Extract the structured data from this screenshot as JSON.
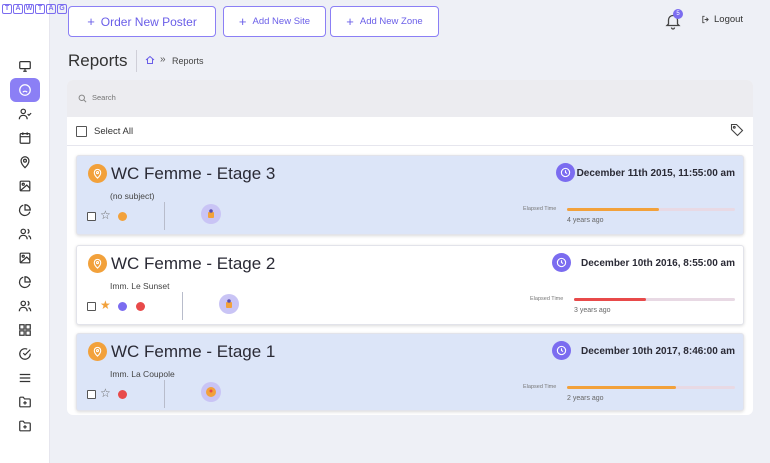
{
  "logo": {
    "letters": [
      "T",
      "A",
      "W",
      "T",
      "A",
      "G"
    ]
  },
  "sidebar": {
    "items": [
      {
        "name": "sidebar-item-monitor",
        "icon": "monitor-icon",
        "active": false
      },
      {
        "name": "sidebar-item-reports",
        "icon": "face-icon",
        "active": true
      },
      {
        "name": "sidebar-item-users-check",
        "icon": "user-check-icon",
        "active": false
      },
      {
        "name": "sidebar-item-calendar",
        "icon": "calendar-icon",
        "active": false
      },
      {
        "name": "sidebar-item-locations",
        "icon": "map-pin-icon",
        "active": false
      },
      {
        "name": "sidebar-item-images",
        "icon": "image-icon",
        "active": false
      },
      {
        "name": "sidebar-item-stats",
        "icon": "pie-chart-icon",
        "active": false
      },
      {
        "name": "sidebar-item-team",
        "icon": "users-icon",
        "active": false
      },
      {
        "name": "sidebar-item-gallery",
        "icon": "image-icon",
        "active": false
      },
      {
        "name": "sidebar-item-analytics",
        "icon": "pie-chart-icon",
        "active": false
      },
      {
        "name": "sidebar-item-people",
        "icon": "users-icon",
        "active": false
      },
      {
        "name": "sidebar-item-grid",
        "icon": "grid-icon",
        "active": false
      },
      {
        "name": "sidebar-item-tasks",
        "icon": "check-circle-icon",
        "active": false
      },
      {
        "name": "sidebar-item-list",
        "icon": "menu-icon",
        "active": false
      },
      {
        "name": "sidebar-item-folder-add",
        "icon": "folder-plus-icon",
        "active": false
      },
      {
        "name": "sidebar-item-folder-new",
        "icon": "folder-plus-icon",
        "active": false
      }
    ]
  },
  "topbar": {
    "order_poster": "Order New Poster",
    "add_site": "Add New Site",
    "add_zone": "Add New Zone",
    "notifications_count": "5",
    "logout": "Logout"
  },
  "page": {
    "title": "Reports",
    "breadcrumb_current": "Reports",
    "breadcrumb_sep": "»"
  },
  "search": {
    "placeholder": "Search"
  },
  "select_all": {
    "label": "Select All"
  },
  "colors": {
    "accent": "#7b6cf0",
    "orange": "#f2a13b",
    "red": "#e84a4a"
  },
  "reports": [
    {
      "title": "WC Femme - Etage 3",
      "subject": "(no subject)",
      "date": "December 11th 2015, 11:55:00 am",
      "elapsed_label": "Elapsed Time",
      "ago": "4 years ago",
      "progress": 0.55,
      "bar_color": "#f2a13b",
      "starred": false,
      "status_dots": [
        "#f2a13b"
      ]
    },
    {
      "title": "WC Femme - Etage 2",
      "subject": "Imm. Le Sunset",
      "date": "December 10th 2016, 8:55:00 am",
      "elapsed_label": "Elapsed Time",
      "ago": "3 years ago",
      "progress": 0.45,
      "bar_color": "#e84a4a",
      "starred": true,
      "status_dots": [
        "#7b6cf0",
        "#e84a4a"
      ]
    },
    {
      "title": "WC Femme - Etage 1",
      "subject": "Imm. La Coupole",
      "date": "December 10th 2017, 8:46:00 am",
      "elapsed_label": "Elapsed Time",
      "ago": "2 years ago",
      "progress": 0.65,
      "bar_color": "#f2a13b",
      "starred": false,
      "status_dots": [
        "#e84a4a"
      ]
    }
  ]
}
